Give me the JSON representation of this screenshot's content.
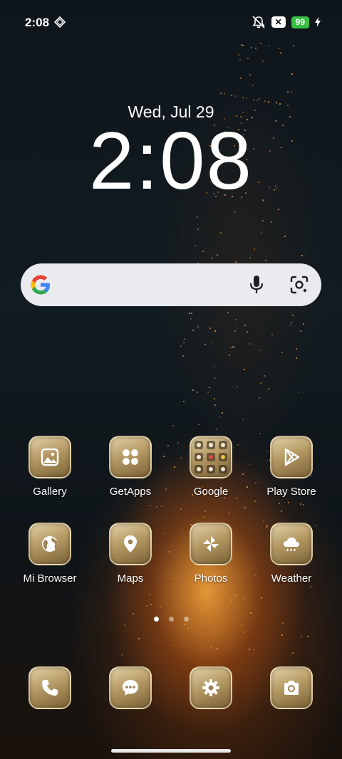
{
  "status_bar": {
    "time": "2:08",
    "battery": "99",
    "icons": [
      "gem-icon",
      "mute-icon",
      "x-notification-icon",
      "charging-icon"
    ]
  },
  "clock": {
    "date": "Wed, Jul 29",
    "time": "2:08"
  },
  "search": {
    "icons": [
      "google-logo",
      "mic-icon",
      "lens-icon"
    ]
  },
  "apps_row1": [
    {
      "label": "Gallery",
      "icon": "gallery-icon"
    },
    {
      "label": "GetApps",
      "icon": "getapps-icon"
    },
    {
      "label": "Google",
      "icon": "folder-icon"
    },
    {
      "label": "Play Store",
      "icon": "play-store-icon"
    }
  ],
  "apps_row2": [
    {
      "label": "Mi Browser",
      "icon": "globe-icon"
    },
    {
      "label": "Maps",
      "icon": "map-pin-icon"
    },
    {
      "label": "Photos",
      "icon": "pinwheel-icon"
    },
    {
      "label": "Weather",
      "icon": "cloud-icon"
    }
  ],
  "dock": [
    {
      "name": "Phone",
      "icon": "phone-icon"
    },
    {
      "name": "Messaging",
      "icon": "message-icon"
    },
    {
      "name": "Settings",
      "icon": "gear-icon"
    },
    {
      "name": "Camera",
      "icon": "camera-icon"
    }
  ],
  "page_indicator": {
    "pages": 3,
    "current": 1
  },
  "colors": {
    "battery": "#36c043",
    "tile": "#b59a64",
    "search_bg": "#e9ebee"
  }
}
